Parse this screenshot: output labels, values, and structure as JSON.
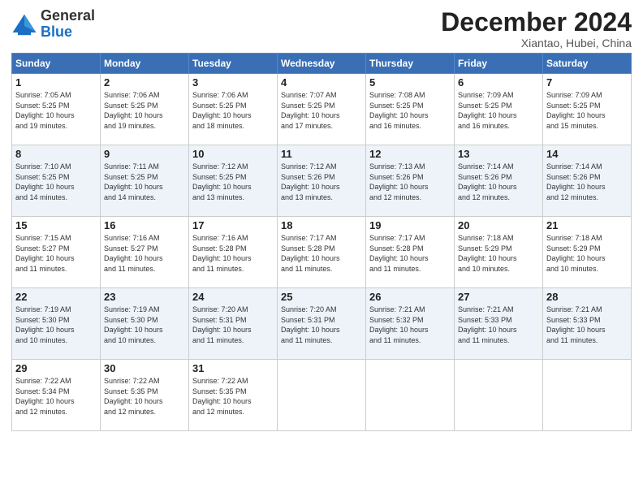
{
  "logo": {
    "general": "General",
    "blue": "Blue"
  },
  "header": {
    "month_title": "December 2024",
    "subtitle": "Xiantao, Hubei, China"
  },
  "days_of_week": [
    "Sunday",
    "Monday",
    "Tuesday",
    "Wednesday",
    "Thursday",
    "Friday",
    "Saturday"
  ],
  "weeks": [
    [
      {
        "day": "1",
        "info": "Sunrise: 7:05 AM\nSunset: 5:25 PM\nDaylight: 10 hours\nand 19 minutes."
      },
      {
        "day": "2",
        "info": "Sunrise: 7:06 AM\nSunset: 5:25 PM\nDaylight: 10 hours\nand 19 minutes."
      },
      {
        "day": "3",
        "info": "Sunrise: 7:06 AM\nSunset: 5:25 PM\nDaylight: 10 hours\nand 18 minutes."
      },
      {
        "day": "4",
        "info": "Sunrise: 7:07 AM\nSunset: 5:25 PM\nDaylight: 10 hours\nand 17 minutes."
      },
      {
        "day": "5",
        "info": "Sunrise: 7:08 AM\nSunset: 5:25 PM\nDaylight: 10 hours\nand 16 minutes."
      },
      {
        "day": "6",
        "info": "Sunrise: 7:09 AM\nSunset: 5:25 PM\nDaylight: 10 hours\nand 16 minutes."
      },
      {
        "day": "7",
        "info": "Sunrise: 7:09 AM\nSunset: 5:25 PM\nDaylight: 10 hours\nand 15 minutes."
      }
    ],
    [
      {
        "day": "8",
        "info": "Sunrise: 7:10 AM\nSunset: 5:25 PM\nDaylight: 10 hours\nand 14 minutes."
      },
      {
        "day": "9",
        "info": "Sunrise: 7:11 AM\nSunset: 5:25 PM\nDaylight: 10 hours\nand 14 minutes."
      },
      {
        "day": "10",
        "info": "Sunrise: 7:12 AM\nSunset: 5:25 PM\nDaylight: 10 hours\nand 13 minutes."
      },
      {
        "day": "11",
        "info": "Sunrise: 7:12 AM\nSunset: 5:26 PM\nDaylight: 10 hours\nand 13 minutes."
      },
      {
        "day": "12",
        "info": "Sunrise: 7:13 AM\nSunset: 5:26 PM\nDaylight: 10 hours\nand 12 minutes."
      },
      {
        "day": "13",
        "info": "Sunrise: 7:14 AM\nSunset: 5:26 PM\nDaylight: 10 hours\nand 12 minutes."
      },
      {
        "day": "14",
        "info": "Sunrise: 7:14 AM\nSunset: 5:26 PM\nDaylight: 10 hours\nand 12 minutes."
      }
    ],
    [
      {
        "day": "15",
        "info": "Sunrise: 7:15 AM\nSunset: 5:27 PM\nDaylight: 10 hours\nand 11 minutes."
      },
      {
        "day": "16",
        "info": "Sunrise: 7:16 AM\nSunset: 5:27 PM\nDaylight: 10 hours\nand 11 minutes."
      },
      {
        "day": "17",
        "info": "Sunrise: 7:16 AM\nSunset: 5:28 PM\nDaylight: 10 hours\nand 11 minutes."
      },
      {
        "day": "18",
        "info": "Sunrise: 7:17 AM\nSunset: 5:28 PM\nDaylight: 10 hours\nand 11 minutes."
      },
      {
        "day": "19",
        "info": "Sunrise: 7:17 AM\nSunset: 5:28 PM\nDaylight: 10 hours\nand 11 minutes."
      },
      {
        "day": "20",
        "info": "Sunrise: 7:18 AM\nSunset: 5:29 PM\nDaylight: 10 hours\nand 10 minutes."
      },
      {
        "day": "21",
        "info": "Sunrise: 7:18 AM\nSunset: 5:29 PM\nDaylight: 10 hours\nand 10 minutes."
      }
    ],
    [
      {
        "day": "22",
        "info": "Sunrise: 7:19 AM\nSunset: 5:30 PM\nDaylight: 10 hours\nand 10 minutes."
      },
      {
        "day": "23",
        "info": "Sunrise: 7:19 AM\nSunset: 5:30 PM\nDaylight: 10 hours\nand 10 minutes."
      },
      {
        "day": "24",
        "info": "Sunrise: 7:20 AM\nSunset: 5:31 PM\nDaylight: 10 hours\nand 11 minutes."
      },
      {
        "day": "25",
        "info": "Sunrise: 7:20 AM\nSunset: 5:31 PM\nDaylight: 10 hours\nand 11 minutes."
      },
      {
        "day": "26",
        "info": "Sunrise: 7:21 AM\nSunset: 5:32 PM\nDaylight: 10 hours\nand 11 minutes."
      },
      {
        "day": "27",
        "info": "Sunrise: 7:21 AM\nSunset: 5:33 PM\nDaylight: 10 hours\nand 11 minutes."
      },
      {
        "day": "28",
        "info": "Sunrise: 7:21 AM\nSunset: 5:33 PM\nDaylight: 10 hours\nand 11 minutes."
      }
    ],
    [
      {
        "day": "29",
        "info": "Sunrise: 7:22 AM\nSunset: 5:34 PM\nDaylight: 10 hours\nand 12 minutes."
      },
      {
        "day": "30",
        "info": "Sunrise: 7:22 AM\nSunset: 5:35 PM\nDaylight: 10 hours\nand 12 minutes."
      },
      {
        "day": "31",
        "info": "Sunrise: 7:22 AM\nSunset: 5:35 PM\nDaylight: 10 hours\nand 12 minutes."
      },
      {
        "day": "",
        "info": ""
      },
      {
        "day": "",
        "info": ""
      },
      {
        "day": "",
        "info": ""
      },
      {
        "day": "",
        "info": ""
      }
    ]
  ]
}
